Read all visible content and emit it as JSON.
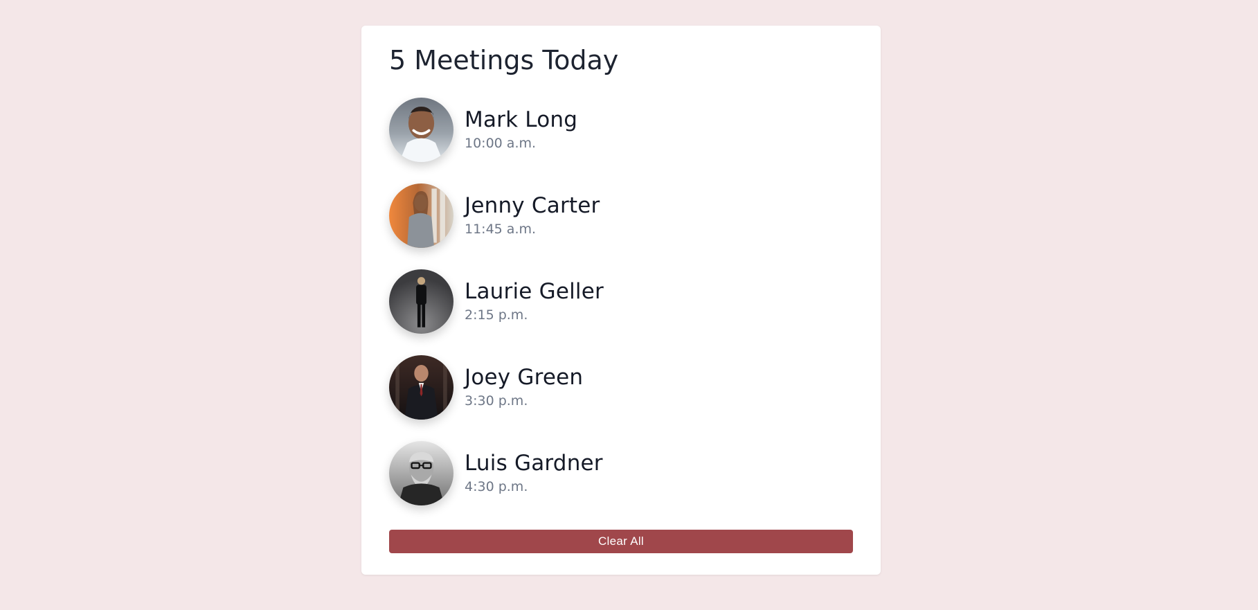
{
  "card": {
    "title": "5 Meetings Today",
    "meetings": [
      {
        "name": "Mark Long",
        "time": "10:00 a.m.",
        "avatar": "avatar-mark-long"
      },
      {
        "name": "Jenny Carter",
        "time": "11:45 a.m.",
        "avatar": "avatar-jenny-carter"
      },
      {
        "name": "Laurie Geller",
        "time": "2:15 p.m.",
        "avatar": "avatar-laurie-geller"
      },
      {
        "name": "Joey Green",
        "time": "3:30 p.m.",
        "avatar": "avatar-joey-green"
      },
      {
        "name": "Luis Gardner",
        "time": "4:30 p.m.",
        "avatar": "avatar-luis-gardner"
      }
    ],
    "clear_label": "Clear All"
  },
  "colors": {
    "background": "#f4e7e8",
    "card": "#ffffff",
    "button": "#a0474b",
    "name_text": "#151a27",
    "time_text": "#6d7686"
  }
}
